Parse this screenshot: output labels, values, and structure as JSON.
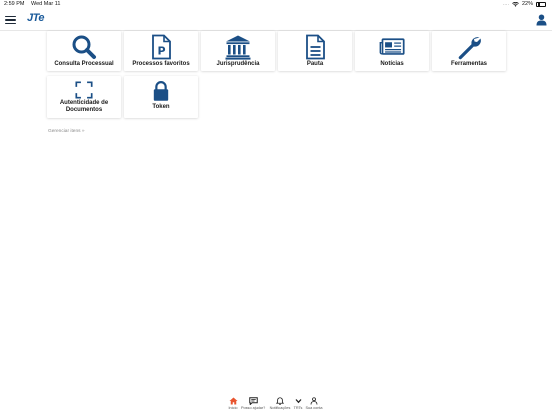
{
  "status": {
    "time": "2:59 PM",
    "date": "Wed Mar 11",
    "signal": "....",
    "battery": "22%"
  },
  "header": {
    "logo": "JTe"
  },
  "tiles": [
    {
      "label": "Consulta Processual",
      "icon": "search-icon"
    },
    {
      "label": "Processos favoritos",
      "icon": "document-p-icon"
    },
    {
      "label": "Jurisprudência",
      "icon": "courthouse-icon"
    },
    {
      "label": "Pauta",
      "icon": "document-lines-icon"
    },
    {
      "label": "Notícias",
      "icon": "newspaper-icon"
    },
    {
      "label": "Ferramentas",
      "icon": "wrench-icon"
    },
    {
      "label": "Autenticidade de Documentos",
      "icon": "scan-frame-icon"
    },
    {
      "label": "Token",
      "icon": "lock-icon"
    }
  ],
  "manage_label": "Gerenciar itens »",
  "tabbar": [
    {
      "label": "Início",
      "icon": "home-icon"
    },
    {
      "label": "Posso ajudar?",
      "icon": "chat-icon"
    },
    {
      "label": "Notificações",
      "icon": "bell-icon"
    },
    {
      "label": "TRTs",
      "icon": "chevron-down-icon"
    },
    {
      "label": "Sua conta",
      "icon": "person-icon"
    }
  ],
  "colors": {
    "accent": "#1a5a9a",
    "icon": "#1b4f86",
    "home": "#e8542f"
  }
}
